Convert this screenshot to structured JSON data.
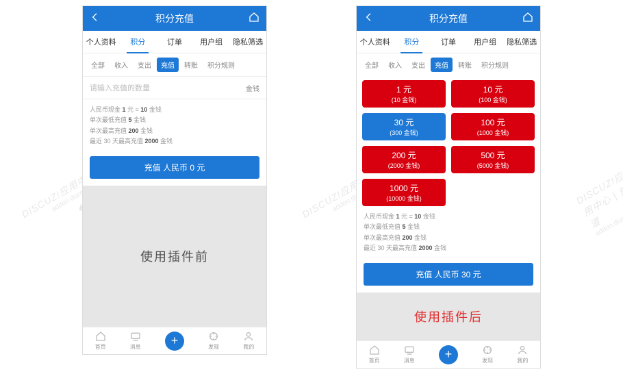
{
  "header": {
    "title": "积分充值"
  },
  "tabs": [
    "个人资料",
    "积分",
    "订单",
    "用户组",
    "隐私筛选"
  ],
  "tabs_active_index": 1,
  "subtabs": [
    "全部",
    "收入",
    "支出",
    "充值",
    "转账",
    "积分规则"
  ],
  "subtabs_active_index": 3,
  "input": {
    "placeholder": "请输入充值的数量",
    "unit": "金钱"
  },
  "rules": [
    {
      "pre": "人民币现金 ",
      "b1": "1",
      "mid": " 元 = ",
      "b2": "10",
      "post": " 金钱"
    },
    {
      "pre": "单次最低充值 ",
      "b1": "5",
      "mid": " 金钱",
      "b2": "",
      "post": ""
    },
    {
      "pre": "单次最高充值 ",
      "b1": "200",
      "mid": " 金钱",
      "b2": "",
      "post": ""
    },
    {
      "pre": "最近 30 天最高充值 ",
      "b1": "2000",
      "mid": " 金钱",
      "b2": "",
      "post": ""
    }
  ],
  "cta_before": "充值 人民币 0 元",
  "cta_after": "充值 人民币 30 元",
  "caption_before": "使用插件前",
  "caption_after": "使用插件后",
  "nav": [
    "首页",
    "消息",
    "",
    "发现",
    "我的"
  ],
  "tiles": [
    {
      "main": "1 元",
      "sub": "(10 金钱)",
      "cls": "red"
    },
    {
      "main": "10 元",
      "sub": "(100 金钱)",
      "cls": "red"
    },
    {
      "main": "30 元",
      "sub": "(300 金钱)",
      "cls": "blue"
    },
    {
      "main": "100 元",
      "sub": "(1000 金钱)",
      "cls": "red"
    },
    {
      "main": "200 元",
      "sub": "(2000 金钱)",
      "cls": "red"
    },
    {
      "main": "500 元",
      "sub": "(5000 金钱)",
      "cls": "red"
    },
    {
      "main": "1000 元",
      "sub": "(10000 金钱)",
      "cls": "red"
    }
  ],
  "watermark": {
    "line1": "DISCUZ!应用中心 | 贰道",
    "line2": "addon.dismall.com"
  }
}
